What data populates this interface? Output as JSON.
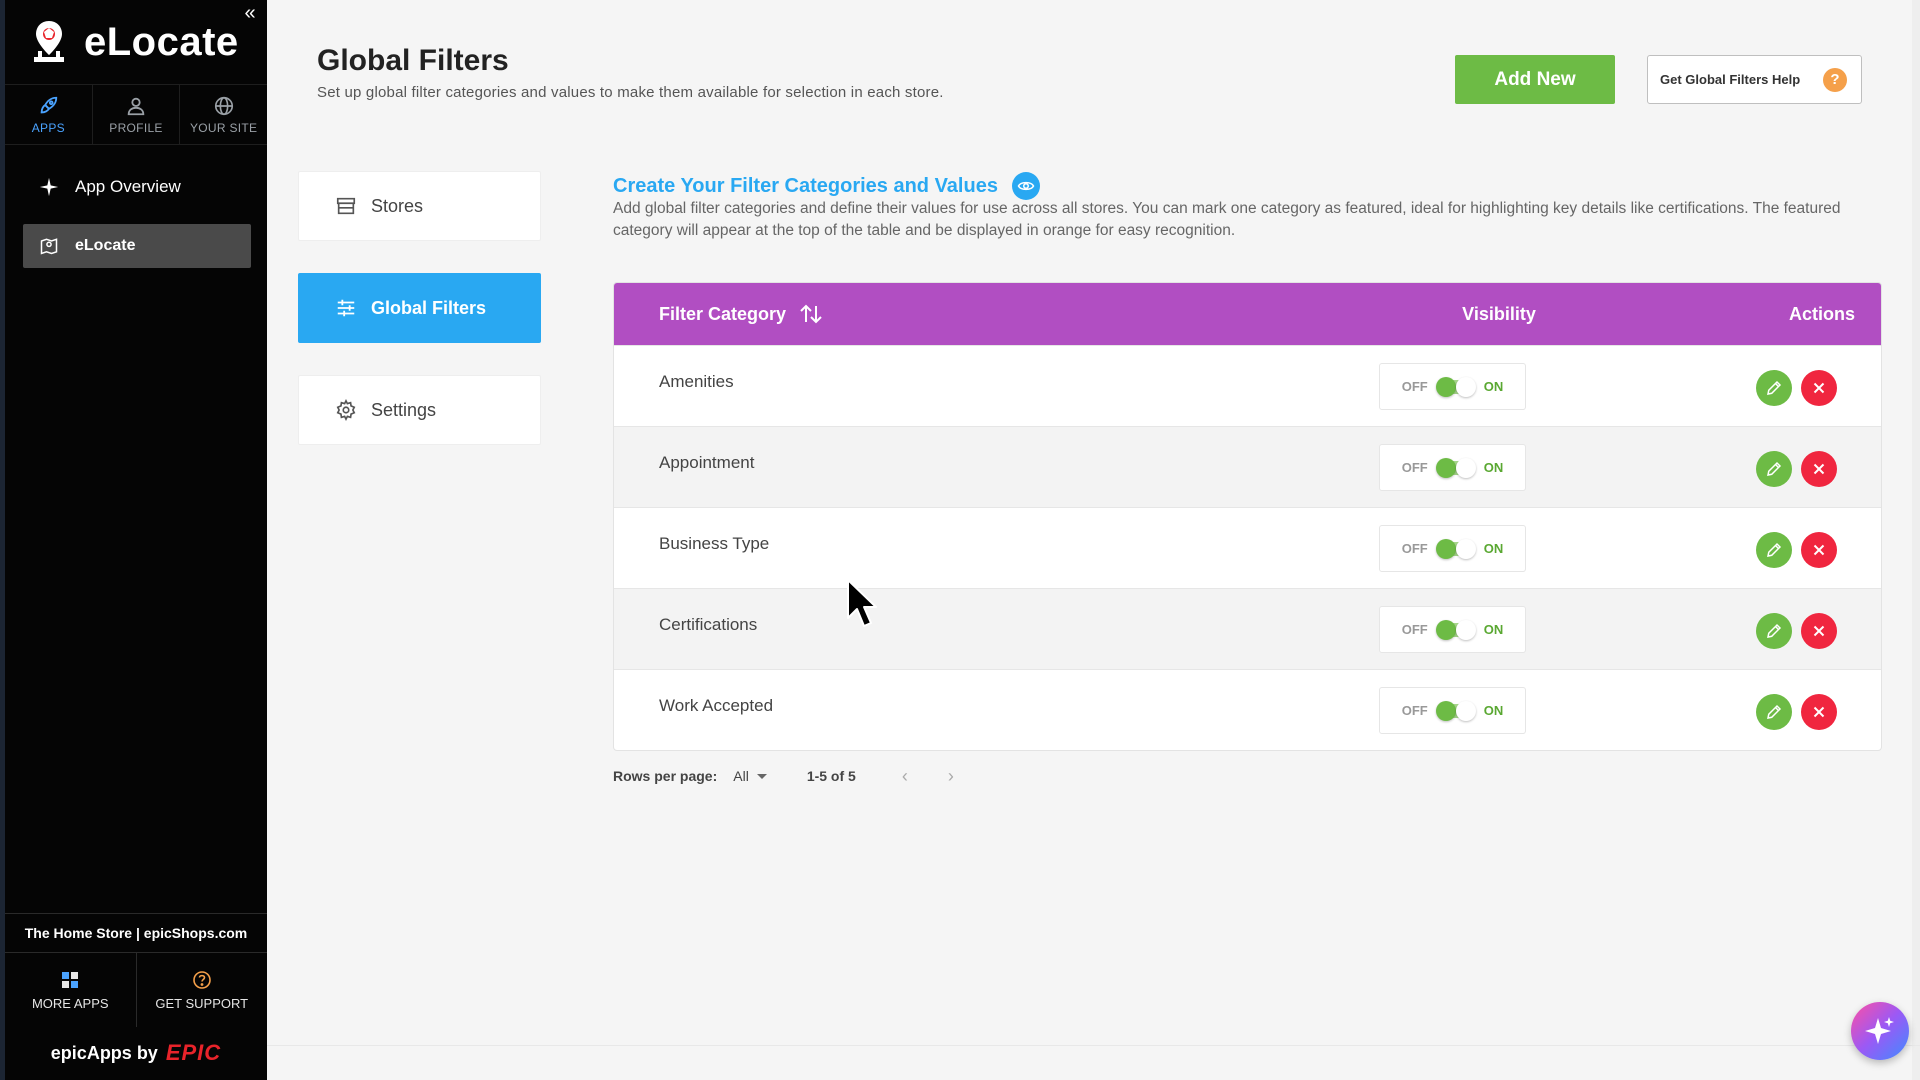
{
  "sidebar": {
    "brand": "eLocate",
    "top_tabs": [
      {
        "label": "APPS",
        "icon": "rocket-icon",
        "active": true
      },
      {
        "label": "PROFILE",
        "icon": "user-icon",
        "active": false
      },
      {
        "label": "YOUR SITE",
        "icon": "globe-icon",
        "active": false
      }
    ],
    "nav": {
      "app_overview": "App Overview",
      "elocate": "eLocate"
    },
    "store_line": "The Home Store | epicShops.com",
    "bottom_tabs": [
      {
        "label": "MORE APPS",
        "icon": "grid-icon"
      },
      {
        "label": "GET SUPPORT",
        "icon": "help-circle-icon"
      }
    ],
    "footer_prefix": "epicApps by",
    "footer_brand": "EPIC"
  },
  "header": {
    "title": "Global Filters",
    "subtitle": "Set up global filter categories and values to make them available for selection in each store.",
    "add_new": "Add New",
    "help": "Get Global Filters Help",
    "help_badge": "?"
  },
  "side_menu": {
    "stores": "Stores",
    "global_filters": "Global Filters",
    "settings": "Settings"
  },
  "section": {
    "title": "Create Your Filter Categories and Values",
    "description": "Add global filter categories and define their values for use across all stores. You can mark one category as featured, ideal for highlighting key details like certifications. The featured category will appear at the top of the table and be displayed in orange for easy recognition."
  },
  "table": {
    "headers": {
      "category": "Filter Category",
      "visibility": "Visibility",
      "actions": "Actions"
    },
    "toggle_off": "OFF",
    "toggle_on": "ON",
    "rows": [
      {
        "name": "Amenities",
        "visible": true
      },
      {
        "name": "Appointment",
        "visible": true
      },
      {
        "name": "Business Type",
        "visible": true
      },
      {
        "name": "Certifications",
        "visible": true
      },
      {
        "name": "Work Accepted",
        "visible": true
      }
    ]
  },
  "pagination": {
    "rows_per_page_label": "Rows per page:",
    "rows_per_page_value": "All",
    "range": "1-5 of 5"
  },
  "colors": {
    "accent_blue": "#29a8f2",
    "header_purple": "#b14ec2",
    "green": "#6dbb45",
    "red": "#f0263f",
    "orange": "#f5a04a"
  }
}
